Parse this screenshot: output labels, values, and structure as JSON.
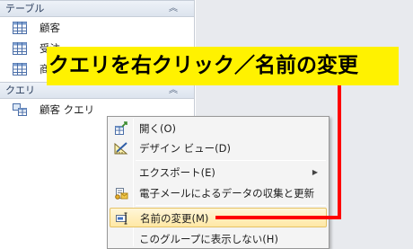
{
  "nav": {
    "tables_header": "テーブル",
    "queries_header": "クエリ",
    "collapse_glyph": "︽",
    "tables": [
      {
        "label": "顧客"
      },
      {
        "label": "受注"
      },
      {
        "label": "商"
      }
    ],
    "queries": [
      {
        "label": "顧客 クエリ"
      }
    ]
  },
  "context_menu": {
    "items": [
      {
        "label": "開く(O)",
        "icon": "open-icon"
      },
      {
        "label": "デザイン ビュー(D)",
        "icon": "design-view-icon"
      },
      {
        "label": "エクスポート(E)",
        "icon": "",
        "submenu_glyph": "▶"
      },
      {
        "label": "電子メールによるデータの収集と更新(L)",
        "icon": "email-collect-icon"
      },
      {
        "label": "名前の変更(M)",
        "icon": "rename-icon",
        "highlighted": true
      },
      {
        "label": "このグループに表示しない(H)",
        "icon": ""
      }
    ]
  },
  "annotation": {
    "text": "クエリを右クリック／名前の変更",
    "color": "#ff0000",
    "background": "#fff200"
  }
}
